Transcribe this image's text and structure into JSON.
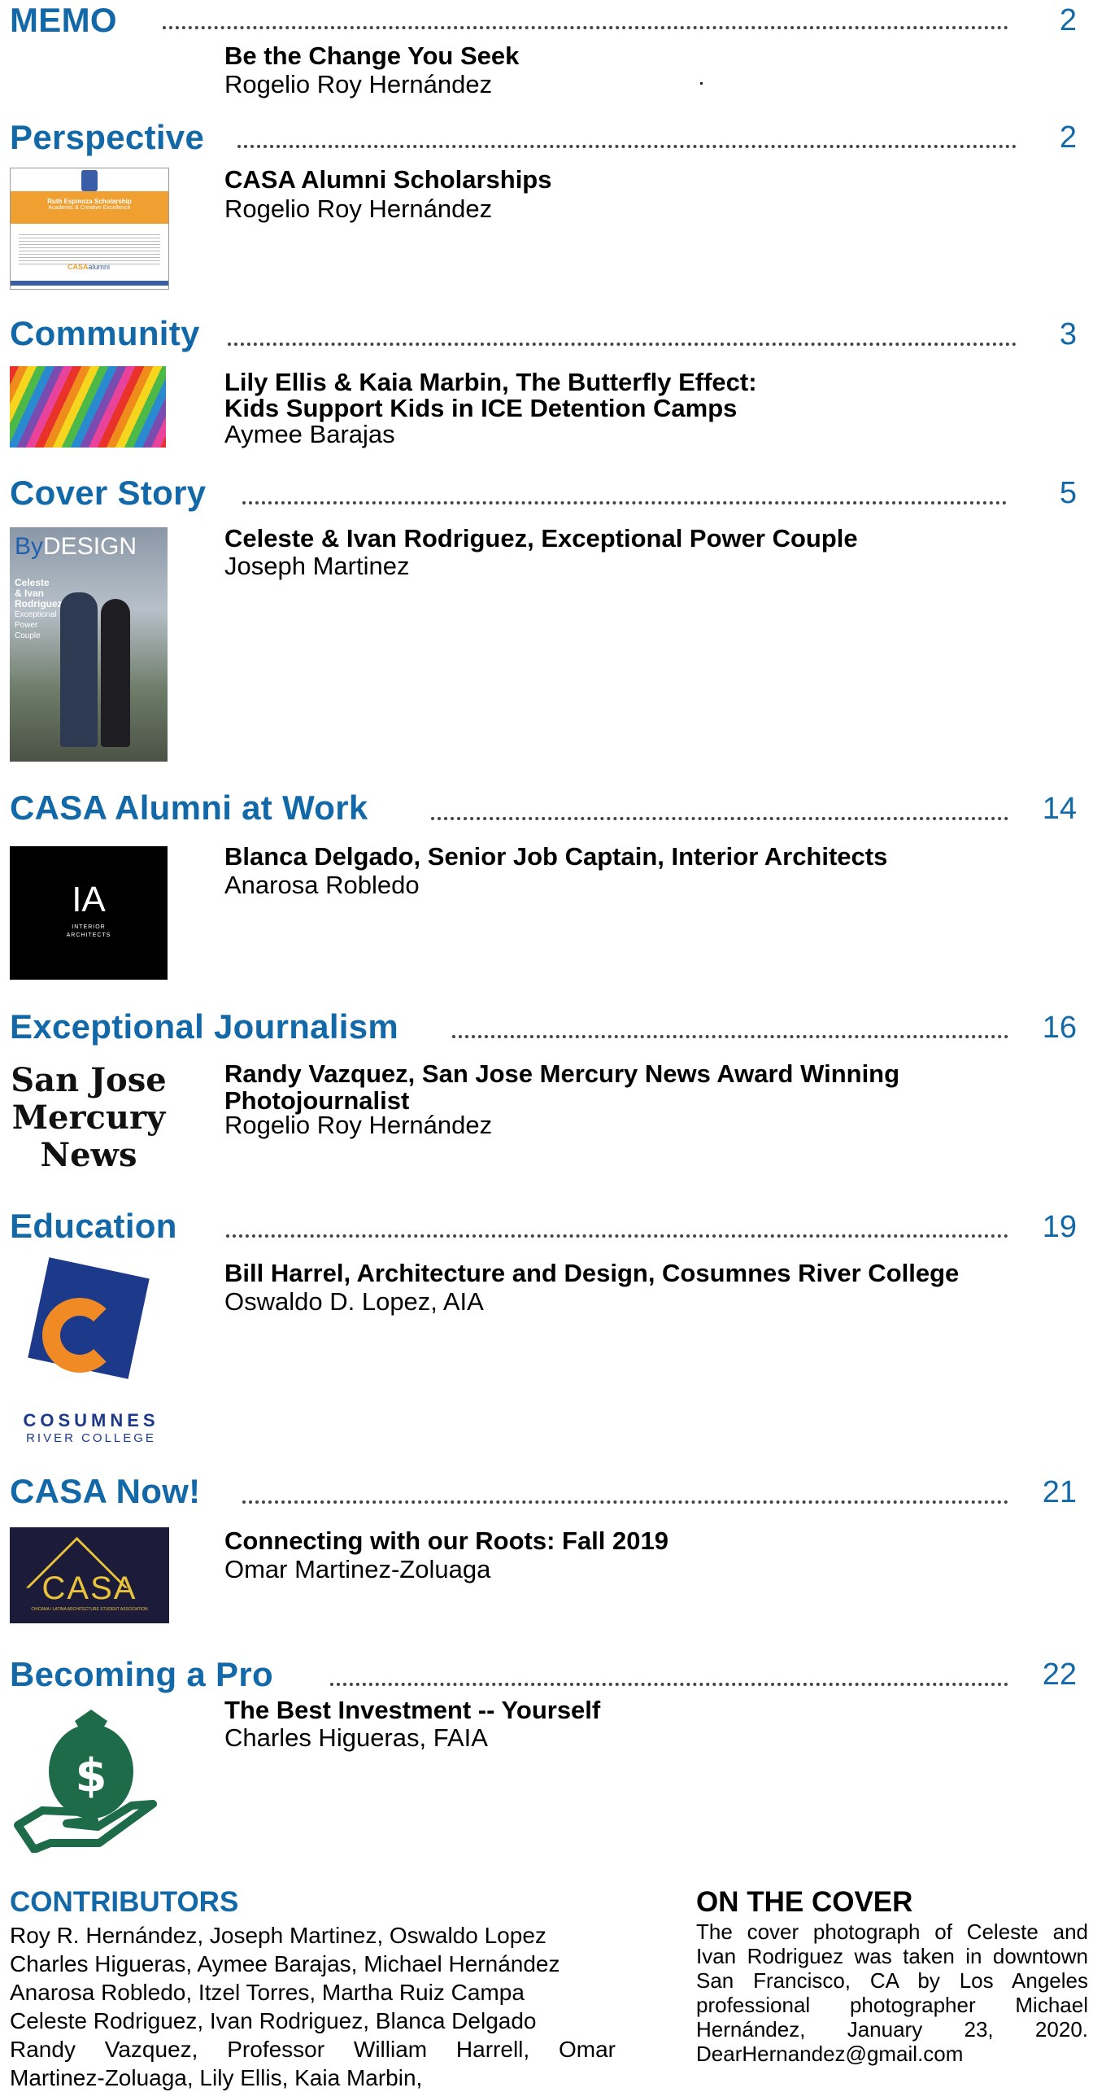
{
  "colors": {
    "accent": "#1369a8",
    "text": "#000000",
    "dots": "#444444"
  },
  "sections": [
    {
      "id": "memo",
      "title": "MEMO",
      "page": "2",
      "article": "Be the Change You Seek",
      "author": "Rogelio Roy Hernández",
      "thumbnail": "none"
    },
    {
      "id": "perspective",
      "title": "Perspective",
      "page": "2",
      "article": "CASA Alumni Scholarships",
      "author": "Rogelio Roy Hernández",
      "thumbnail": "scholarship-certificate",
      "thumb_text": {
        "line1": "Ruth Espinoza Scholarship",
        "line2": "Academic & Creative Excellence",
        "brand_a": "CASA",
        "brand_b": "alumni"
      }
    },
    {
      "id": "community",
      "title": "Community",
      "page": "3",
      "article_lines": [
        "Lily Ellis & Kaia Marbin, The Butterfly Effect:",
        "Kids Support Kids in ICE Detention Camps"
      ],
      "author": "Aymee Barajas",
      "thumbnail": "colorful-butterflies"
    },
    {
      "id": "cover-story",
      "title": "Cover Story",
      "page": "5",
      "article": "Celeste & Ivan Rodriguez, Exceptional Power Couple",
      "author": "Joseph Martinez",
      "thumbnail": "magazine-cover",
      "thumb_text": {
        "mast_a": "By",
        "mast_b": "DESIGN",
        "cover_line1": "Celeste",
        "cover_line2": "& Ivan",
        "cover_line3": "Rodriguez",
        "cover_line4": "Exceptional",
        "cover_line5": "Power",
        "cover_line6": "Couple"
      }
    },
    {
      "id": "alumni-at-work",
      "title": "CASA Alumni at Work",
      "page": "14",
      "article": "Blanca Delgado, Senior Job Captain, Interior Architects",
      "author": "Anarosa Robledo",
      "thumbnail": "ia-logo",
      "thumb_text": {
        "mark": "IA",
        "line1": "INTERIOR",
        "line2": "ARCHITECTS"
      }
    },
    {
      "id": "journalism",
      "title": "Exceptional Journalism",
      "page": "16",
      "article_lines": [
        "Randy Vazquez, San Jose Mercury News Award Winning",
        "Photojournalist"
      ],
      "author": "Rogelio Roy Hernández",
      "thumbnail": "mercury-news-logo",
      "thumb_text": {
        "line1": "San Jose",
        "line2": "Mercury",
        "line3": "News"
      }
    },
    {
      "id": "education",
      "title": "Education",
      "page": "19",
      "article": "Bill Harrel, Architecture and Design, Cosumnes River College",
      "author": "Oswaldo D. Lopez, AIA",
      "thumbnail": "cosumnes-logo",
      "thumb_text": {
        "line1": "COSUMNES",
        "line2": "RIVER COLLEGE"
      }
    },
    {
      "id": "casa-now",
      "title": "CASA Now!",
      "page": "21",
      "article": "Connecting with our Roots: Fall 2019",
      "author": "Omar Martinez-Zoluaga",
      "thumbnail": "casa-logo",
      "thumb_text": {
        "mark": "CASA",
        "sub": "CHICANA / LATINA ARCHITECTURE STUDENT ASSOCIATION"
      }
    },
    {
      "id": "becoming-a-pro",
      "title": "Becoming a Pro",
      "page": "22",
      "article": "The Best Investment -- Yourself",
      "author": "Charles Higueras, FAIA",
      "thumbnail": "money-bag-hand-icon"
    }
  ],
  "contributors": {
    "heading": "CONTRIBUTORS",
    "lines": [
      "Roy R. Hernández, Joseph Martinez, Oswaldo Lopez",
      "Charles Higueras, Aymee Barajas, Michael Hernández",
      "Anarosa Robledo, Itzel Torres, Martha Ruiz Campa",
      "Celeste Rodriguez, Ivan Rodriguez, Blanca Delgado",
      "Randy Vazquez, Professor William Harrell, Omar",
      "Martinez-Zoluaga, Lily Ellis, Kaia Marbin,"
    ]
  },
  "on_the_cover": {
    "heading": "ON THE COVER",
    "text": "The cover photograph of Celeste and Ivan Rodriguez was taken in downtown San Francisco, CA by Los Angeles professional photographer Michael Hernández, January 23, 2020. DearHernandez@gmail.com"
  }
}
